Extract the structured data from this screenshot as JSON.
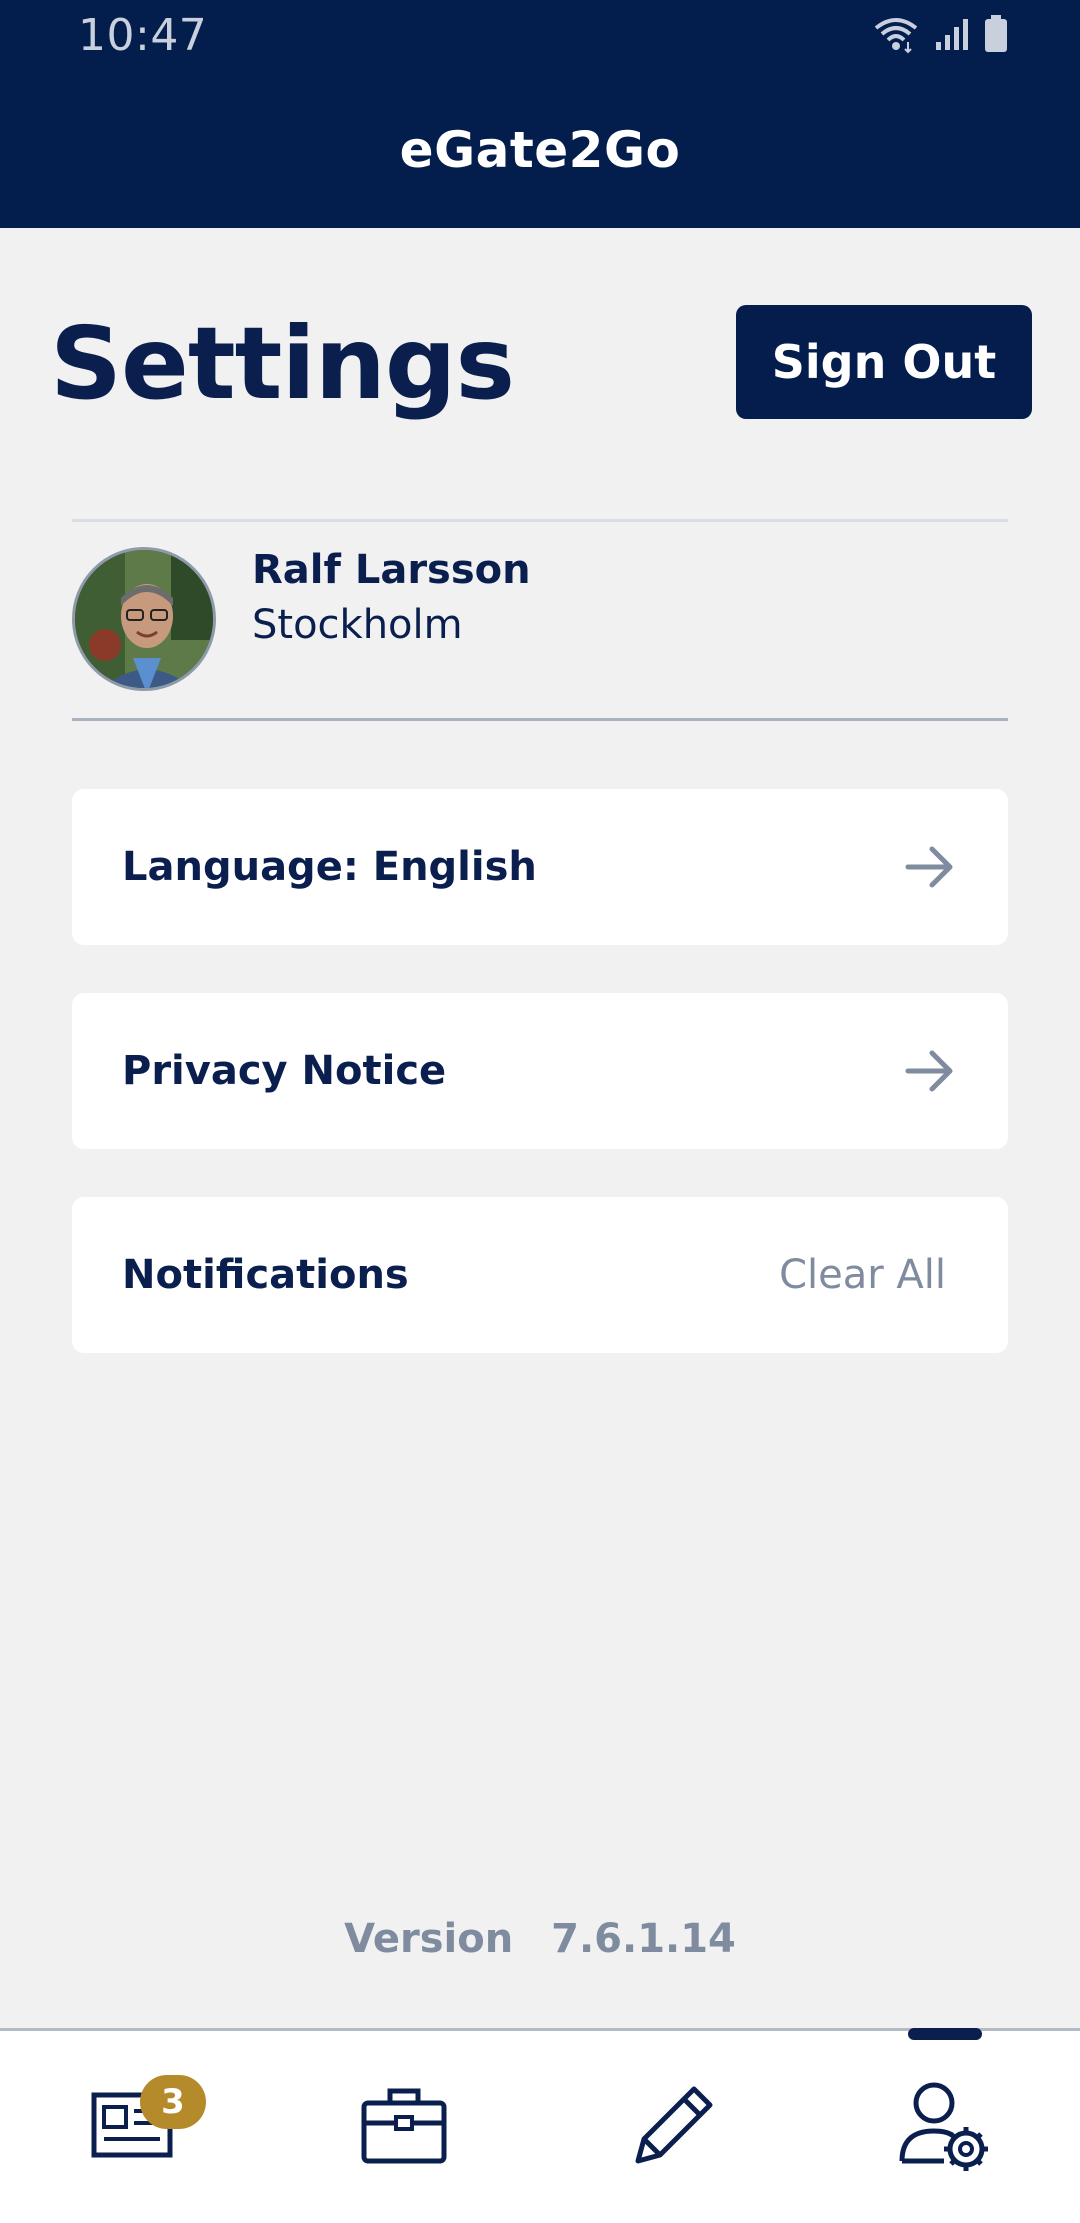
{
  "status_bar": {
    "time": "10:47"
  },
  "app_bar": {
    "title": "eGate2Go"
  },
  "page": {
    "title": "Settings",
    "sign_out_label": "Sign Out"
  },
  "profile": {
    "name": "Ralf Larsson",
    "city": "Stockholm"
  },
  "settings": {
    "language_label": "Language: English",
    "privacy_label": "Privacy Notice",
    "notifications_label": "Notifications",
    "clear_all_label": "Clear All"
  },
  "version": {
    "label": "Version",
    "number": "7.6.1.14"
  },
  "bottom_nav": {
    "badge_count": "3",
    "items": [
      "news-icon",
      "briefcase-icon",
      "pencil-icon",
      "user-settings-icon"
    ],
    "active_index": 3
  },
  "colors": {
    "primary": "#031d4c",
    "background": "#f1f1f2",
    "muted_text": "#7f8b9e",
    "badge": "#b58a2a"
  }
}
